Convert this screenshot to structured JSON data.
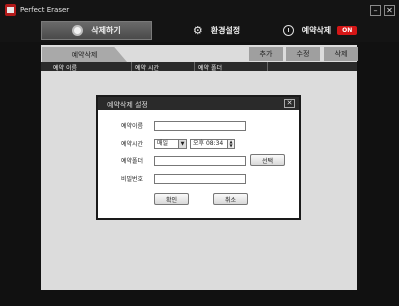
{
  "app": {
    "title": "Perfect Eraser"
  },
  "window_controls": {
    "minimize": "–",
    "close": "✕"
  },
  "nav": {
    "delete_label": "삭제하기",
    "settings_label": "환경설정",
    "schedule_label": "예약삭제",
    "schedule_status": "ON",
    "schedule_status_color": "#d51616"
  },
  "content": {
    "tab_label": "예약삭제",
    "actions": {
      "add": "추가",
      "edit": "수정",
      "delete": "삭제"
    },
    "columns": [
      "예약 이름",
      "예약 시간",
      "예약 폴더"
    ]
  },
  "dialog": {
    "title": "예약삭제 설정",
    "close": "✕",
    "labels": {
      "name": "예약이름",
      "time": "예약시간",
      "folder": "예약폴더",
      "password": "비밀번호"
    },
    "values": {
      "name": "",
      "frequency": "매일",
      "time": "오후 08:34",
      "folder": "",
      "password": ""
    },
    "select_button": "선택",
    "confirm_button": "확인",
    "cancel_button": "취소"
  }
}
